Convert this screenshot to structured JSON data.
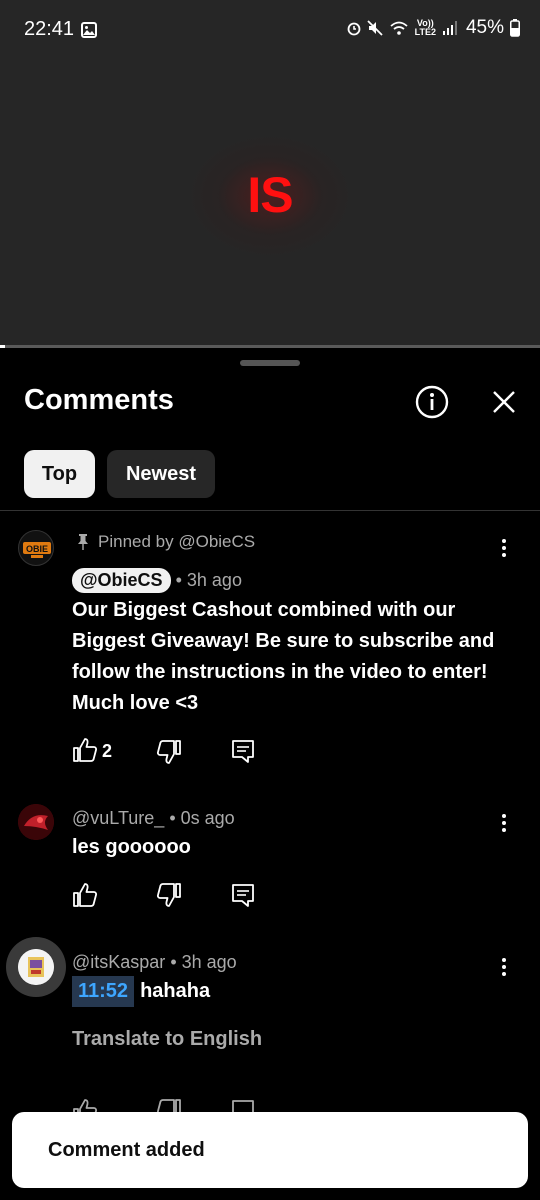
{
  "status_bar": {
    "time": "22:41",
    "lte_top": "Vo))",
    "lte_bottom": "LTE2",
    "battery": "45%"
  },
  "video": {
    "overlay_text": "IS",
    "progress_fraction": 0.01
  },
  "comments_panel": {
    "title": "Comments",
    "filters": {
      "top": "Top",
      "newest": "Newest",
      "selected": "Top"
    }
  },
  "comments": [
    {
      "pinned_label": "Pinned by @ObieCS",
      "author": "@ObieCS",
      "time": "• 3h ago",
      "text": "Our Biggest Cashout combined with our Biggest Giveaway! Be sure to subscribe and follow the instructions in the video to enter! Much love <3",
      "likes": "2",
      "avatar_text": "OBIE"
    },
    {
      "author": "@vuLTure_",
      "time": "• 0s ago",
      "text": "les goooooo"
    },
    {
      "author": "@itsKaspar",
      "time": "• 3h ago",
      "timestamp_link": "11:52",
      "text": "hahaha",
      "translate_label": "Translate to English"
    }
  ],
  "toast": {
    "message": "Comment added"
  },
  "colors": {
    "video_text": "#ff1010",
    "timestamp_link": "#3ea6ff",
    "chip_selected_bg": "#f1f1f1",
    "chip_bg": "#272727"
  }
}
